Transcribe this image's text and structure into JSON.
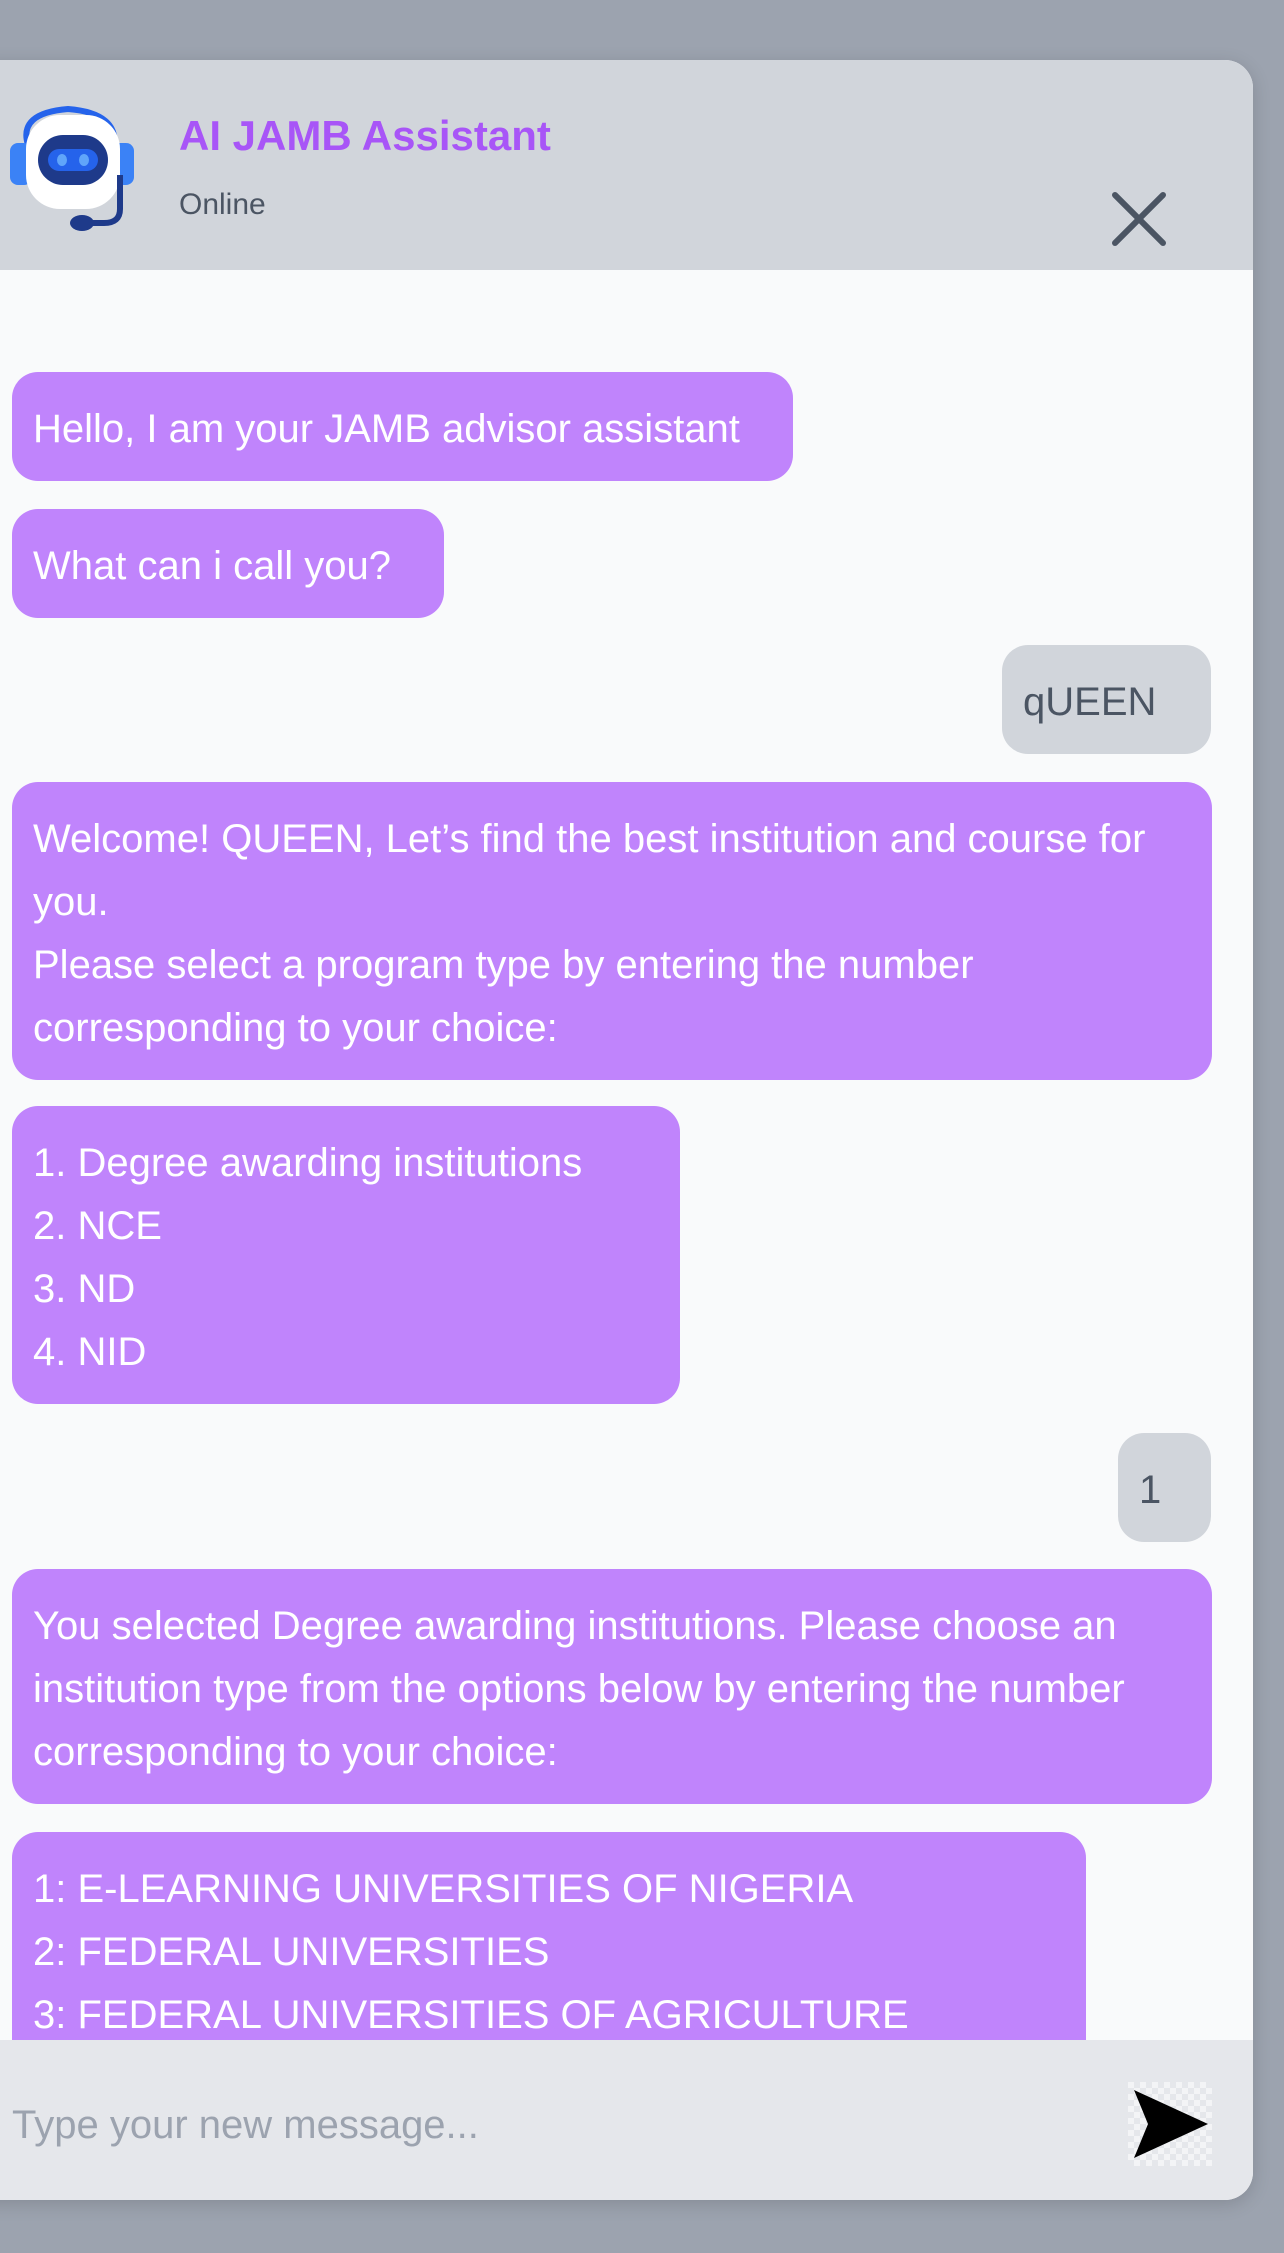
{
  "header": {
    "title": "AI JAMB Assistant",
    "status": "Online"
  },
  "messages": [
    {
      "from": "bot",
      "text": "Hello, I am your JAMB advisor assistant"
    },
    {
      "from": "bot",
      "text": "What can i call you?"
    },
    {
      "from": "user",
      "text": "qUEEN"
    },
    {
      "from": "bot",
      "text": "Welcome! QUEEN, Let’s find the best institution and course for you.\nPlease select a program type by entering the number corresponding to your choice:"
    },
    {
      "from": "bot",
      "text": "1. Degree awarding institutions\n2. NCE\n3. ND\n4. NID"
    },
    {
      "from": "user",
      "text": "1"
    },
    {
      "from": "bot",
      "text": "You selected Degree awarding institutions. Please choose an institution type from the options below by entering the number corresponding to your choice:"
    },
    {
      "from": "bot",
      "text": "1: E-LEARNING UNIVERSITIES OF NIGERIA\n2: FEDERAL UNIVERSITIES\n3: FEDERAL UNIVERSITIES OF AGRICULTURE"
    }
  ],
  "composer": {
    "placeholder": "Type your new message...",
    "value": ""
  },
  "icons": {
    "avatar": "robot-headset-icon",
    "close": "close-icon",
    "send": "send-icon"
  },
  "colors": {
    "accent": "#a855f7",
    "bot_bubble": "#c084fc",
    "user_bubble": "#d1d5db",
    "header_bg": "#d1d5db",
    "composer_bg": "#e5e7eb"
  }
}
